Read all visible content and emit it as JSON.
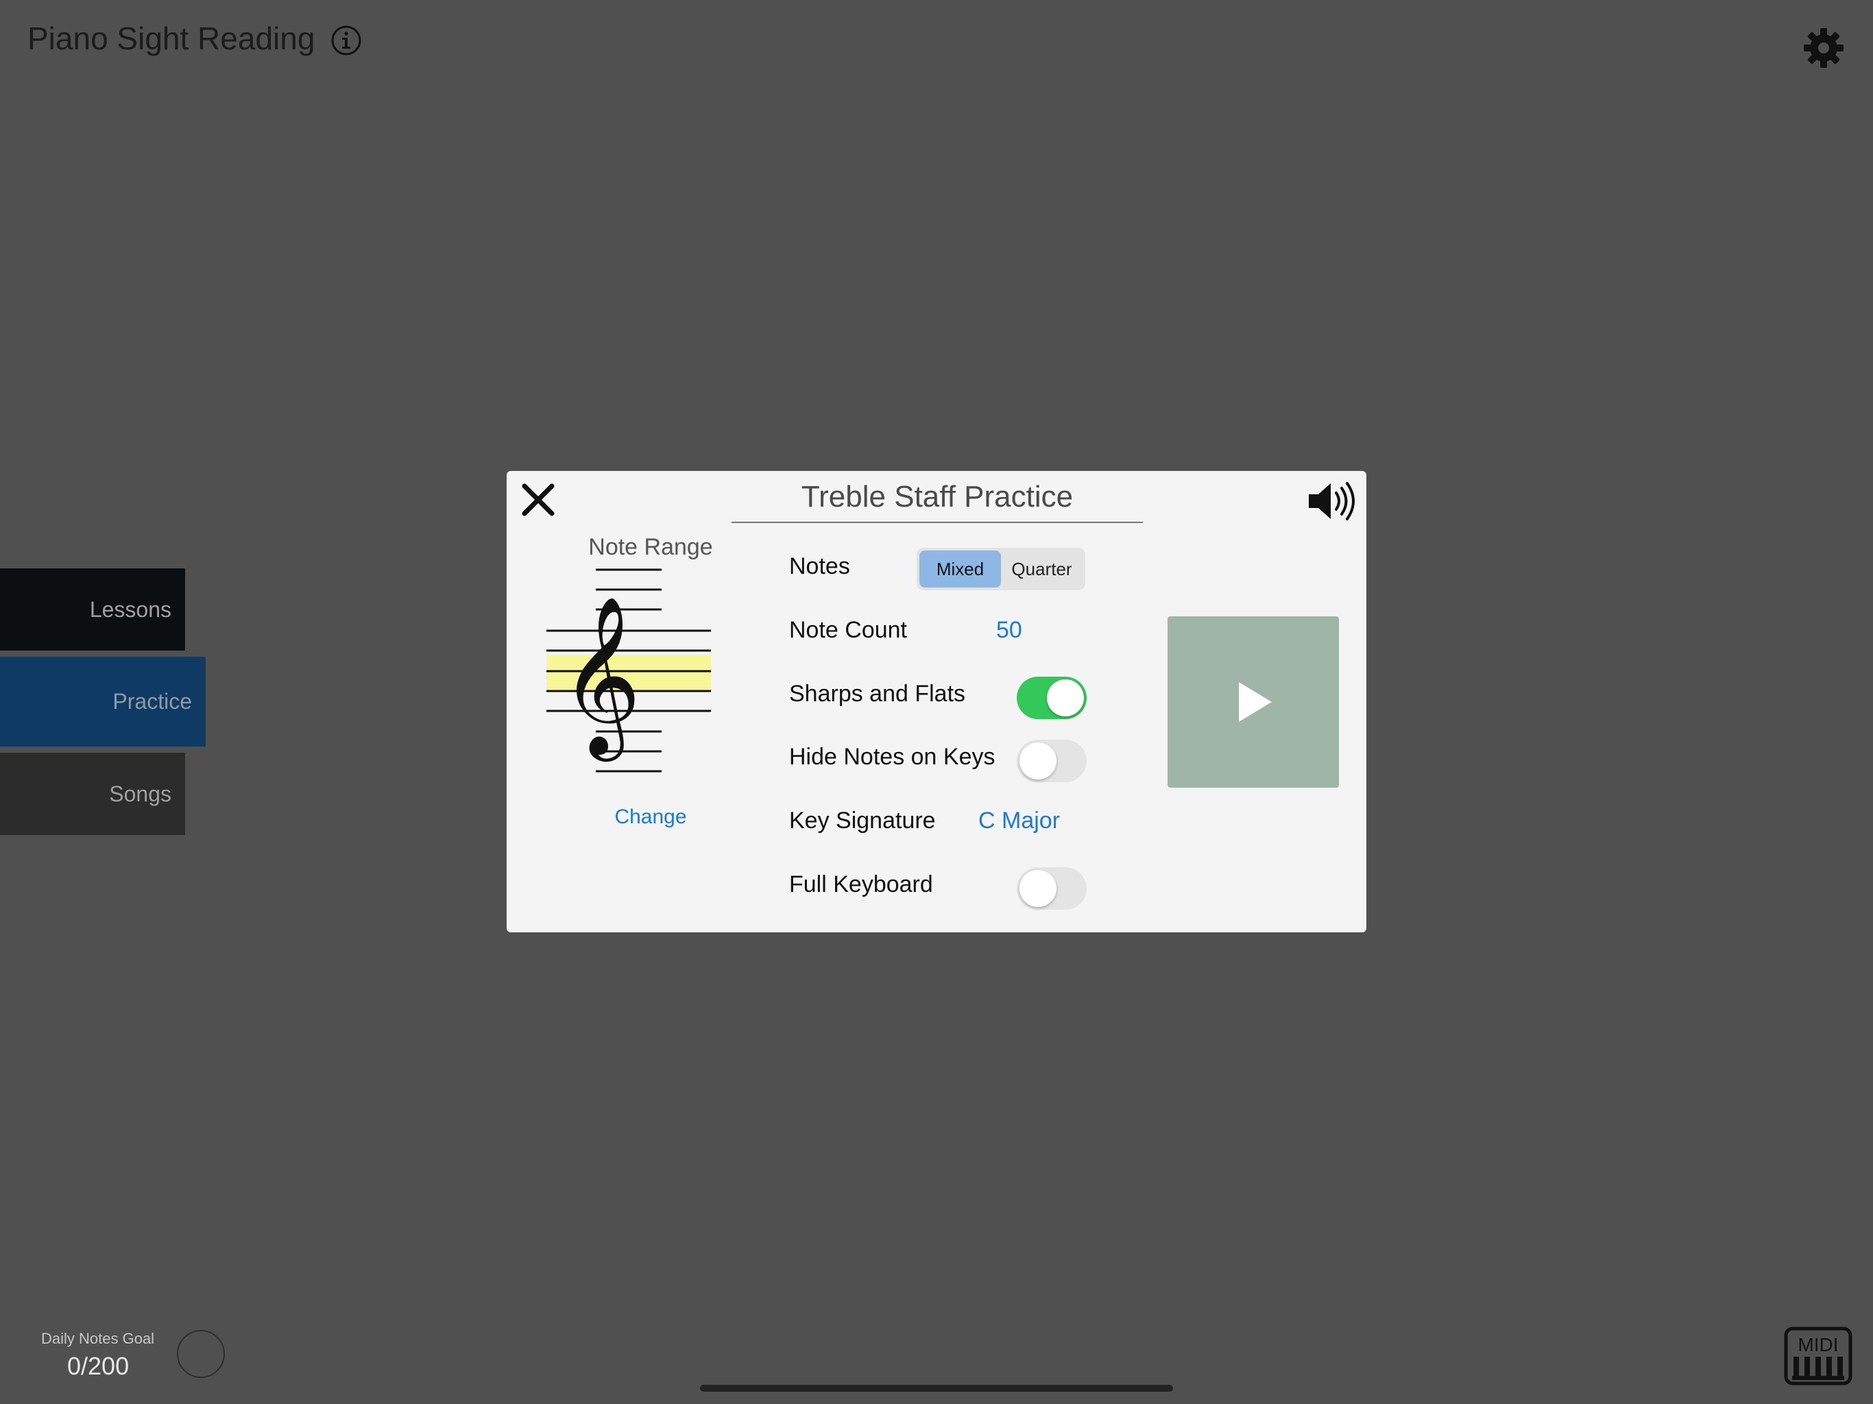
{
  "header": {
    "title": "Piano Sight Reading"
  },
  "nav": {
    "items": [
      {
        "label": "Lessons"
      },
      {
        "label": "Practice"
      },
      {
        "label": "Songs"
      }
    ]
  },
  "goal": {
    "label": "Daily Notes Goal",
    "value": "0/200"
  },
  "midi": {
    "label": "MIDI"
  },
  "modal": {
    "title": "Treble Staff Practice",
    "note_range_label": "Note Range",
    "change_label": "Change",
    "rows": {
      "notes_label": "Notes",
      "notes_options": [
        "Mixed",
        "Quarter"
      ],
      "notes_selected": "Mixed",
      "count_label": "Note Count",
      "count_value": "50",
      "sharps_label": "Sharps and Flats",
      "sharps_on": true,
      "hide_label": "Hide Notes on Keys",
      "hide_on": false,
      "key_label": "Key Signature",
      "key_value": "C Major",
      "full_label": "Full Keyboard",
      "full_on": false
    }
  },
  "colors": {
    "background": "#505050",
    "accent_link": "#1a7ad4",
    "toggle_on": "#34c759",
    "segment_active": "#8db8e6",
    "range_highlight": "#f7f79a",
    "play_box": "#9fb5a7",
    "practice_tab": "#0f3a63"
  },
  "icons": {
    "info": "info-circle-icon",
    "settings": "gear-icon",
    "close": "close-icon",
    "sound": "speaker-icon",
    "play": "play-icon",
    "midi": "midi-keyboard-icon",
    "clef": "treble-clef-icon"
  }
}
